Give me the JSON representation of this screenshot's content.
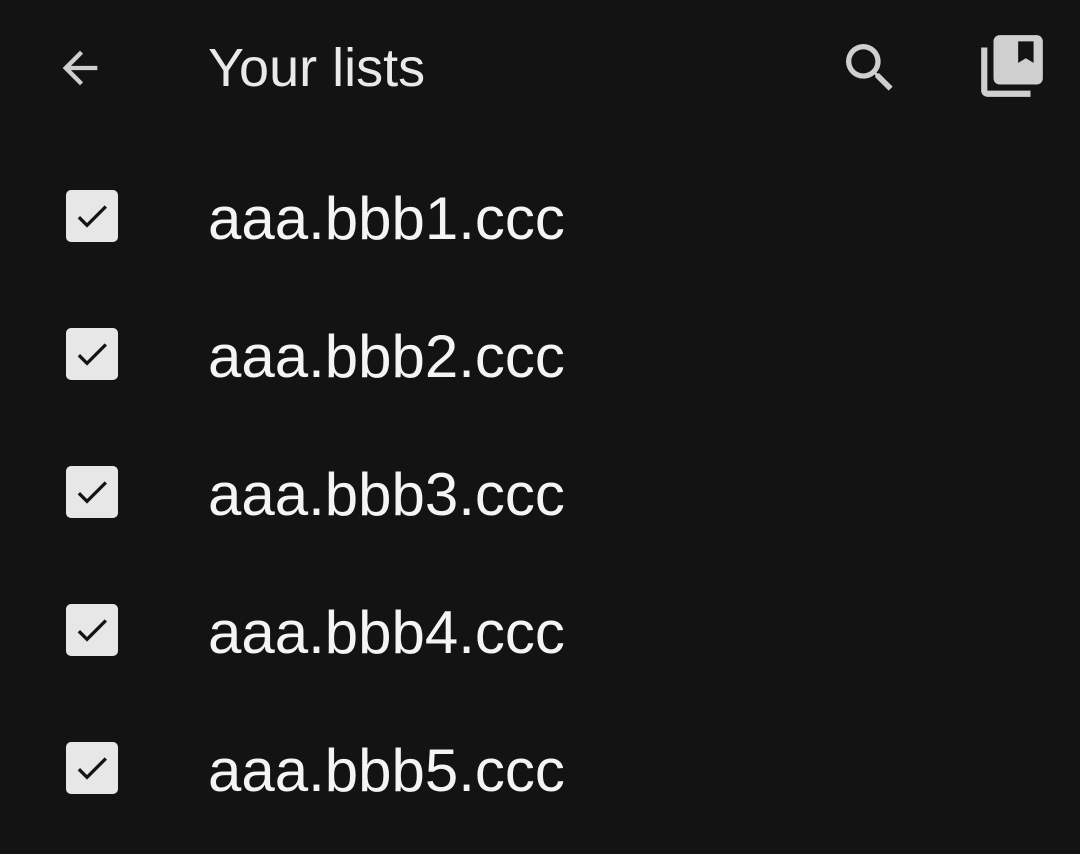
{
  "header": {
    "title": "Your lists",
    "back_icon": "arrow-back-icon",
    "search_icon": "search-icon",
    "library_icon": "library-bookmark-icon"
  },
  "colors": {
    "background": "#131313",
    "text": "#f4f4f4",
    "icon": "#cfcfcf",
    "checkbox_fill": "#e7e7e7",
    "checkmark": "#131313"
  },
  "lists": [
    {
      "label": "aaa.bbb1.ccc",
      "checked": true
    },
    {
      "label": "aaa.bbb2.ccc",
      "checked": true
    },
    {
      "label": "aaa.bbb3.ccc",
      "checked": true
    },
    {
      "label": "aaa.bbb4.ccc",
      "checked": true
    },
    {
      "label": "aaa.bbb5.ccc",
      "checked": true
    }
  ]
}
